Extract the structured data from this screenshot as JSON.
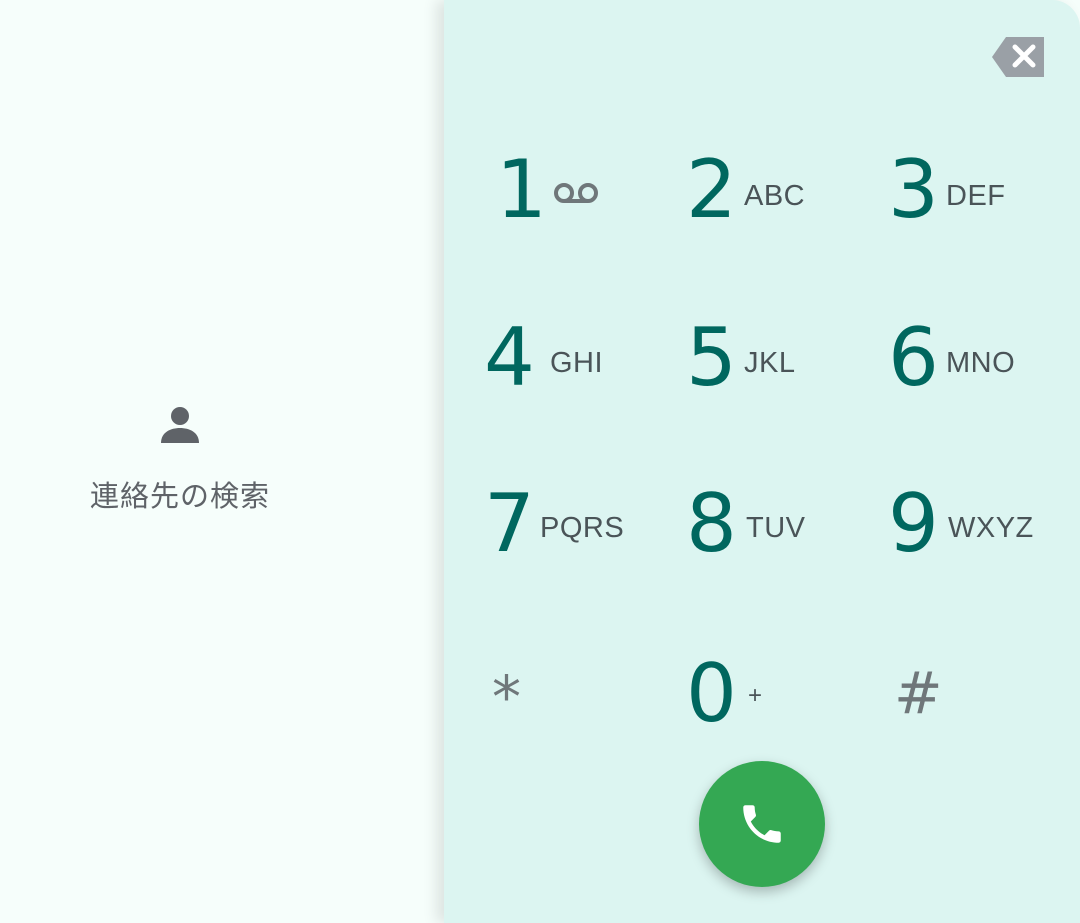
{
  "search": {
    "label": "連絡先の検索",
    "icon": "person-icon"
  },
  "dialpad": {
    "keys": [
      {
        "digit": "1",
        "letters": "",
        "icon": "voicemail-icon"
      },
      {
        "digit": "2",
        "letters": "ABC"
      },
      {
        "digit": "3",
        "letters": "DEF"
      },
      {
        "digit": "4",
        "letters": "GHI"
      },
      {
        "digit": "5",
        "letters": "JKL"
      },
      {
        "digit": "6",
        "letters": "MNO"
      },
      {
        "digit": "7",
        "letters": "PQRS"
      },
      {
        "digit": "8",
        "letters": "TUV"
      },
      {
        "digit": "9",
        "letters": "WXYZ"
      },
      {
        "digit": "*",
        "letters": ""
      },
      {
        "digit": "0",
        "letters": "+"
      },
      {
        "digit": "#",
        "letters": ""
      }
    ],
    "backspace_icon": "backspace-icon",
    "call_icon": "phone-icon"
  },
  "colors": {
    "digit": "#00675f",
    "letters": "#4a5458",
    "dialpad_background": "#dcf5f1",
    "call_button": "#34a853",
    "backspace": "#9aa0a6"
  }
}
